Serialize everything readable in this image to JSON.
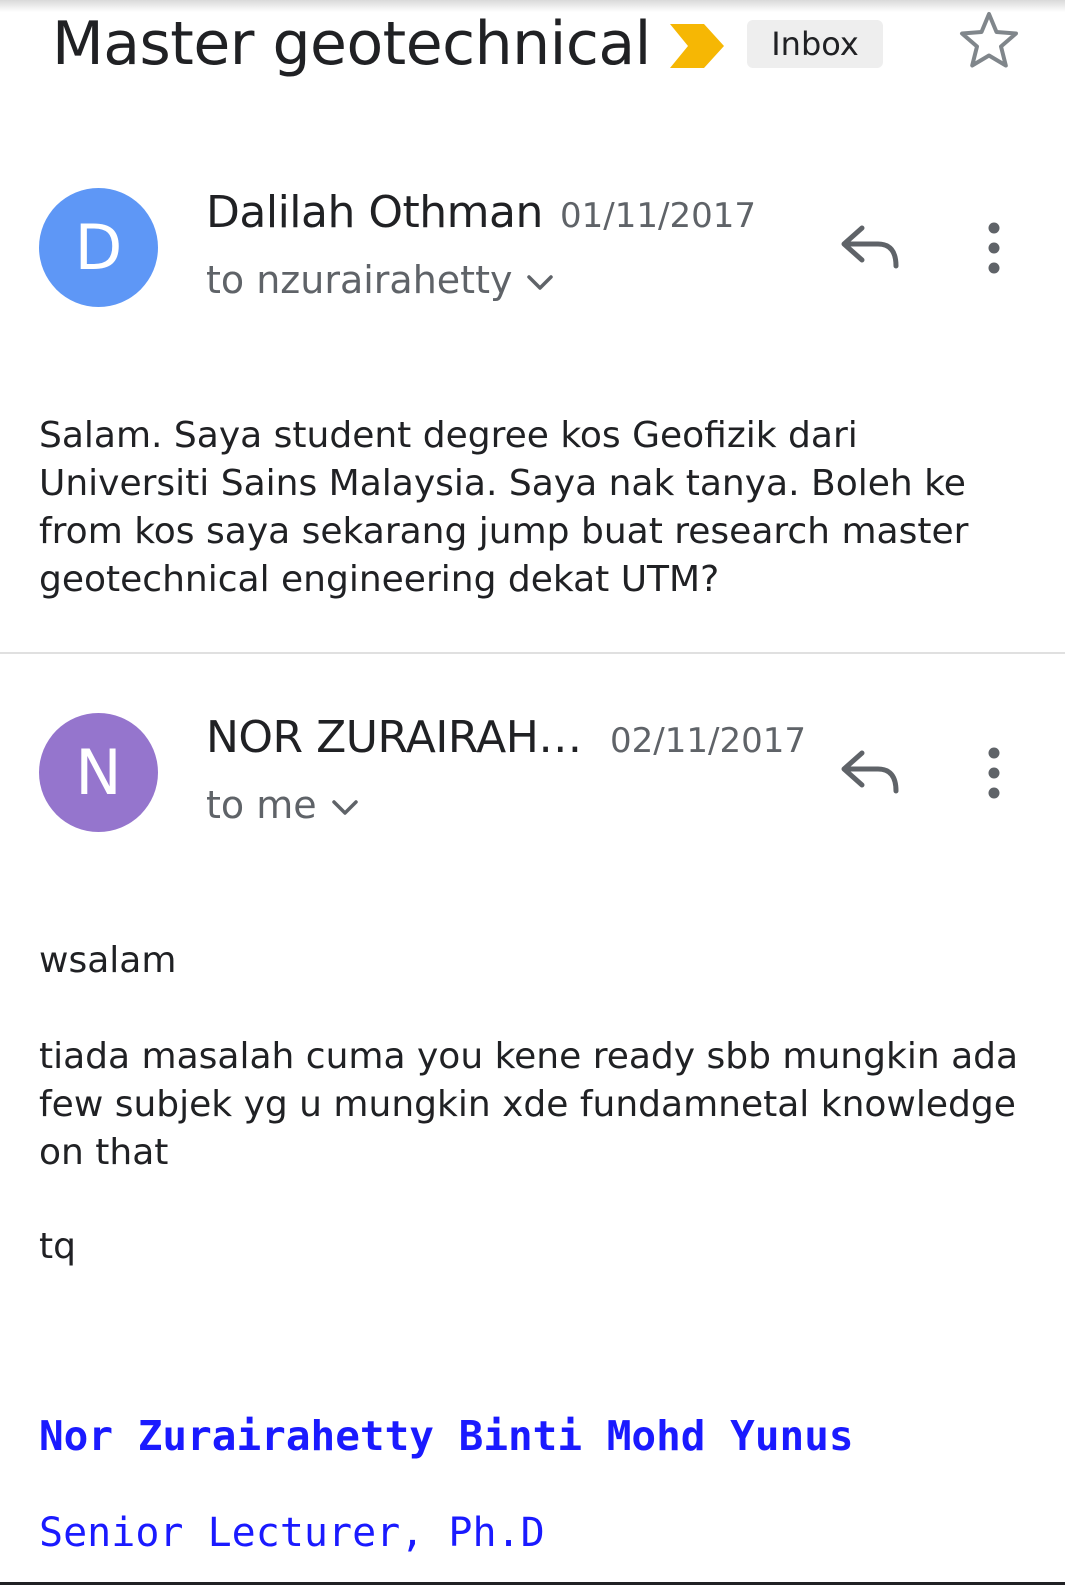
{
  "thread": {
    "subject": "Master geotechnical",
    "label": "Inbox",
    "icons": {
      "important": "importance-marker-icon",
      "star": "star-icon"
    }
  },
  "colors": {
    "important": "#f6b704",
    "avatar_d": "#5e97f6",
    "avatar_n": "#9575cd",
    "signature": "#1a1aff"
  },
  "messages": [
    {
      "avatar_letter": "D",
      "sender": "Dalilah Othman",
      "date": "01/11/2017",
      "recipient": "to nzurairahetty",
      "body": "Salam. Saya student degree kos Geofizik dari Universiti Sains Malaysia. Saya nak tanya. Boleh ke from kos saya sekarang jump buat research master geotechnical engineering dekat UTM?"
    },
    {
      "avatar_letter": "N",
      "sender": "NOR ZURAIRAH…",
      "date": "02/11/2017",
      "recipient": "to me",
      "body_lines": [
        "wsalam",
        "tiada masalah cuma you kene ready sbb mungkin ada few subjek yg u mungkin xde fundamnetal knowledge on that",
        "tq"
      ],
      "signature": {
        "name": "Nor Zurairahetty Binti Mohd Yunus",
        "title": "Senior Lecturer, Ph.D"
      }
    }
  ]
}
